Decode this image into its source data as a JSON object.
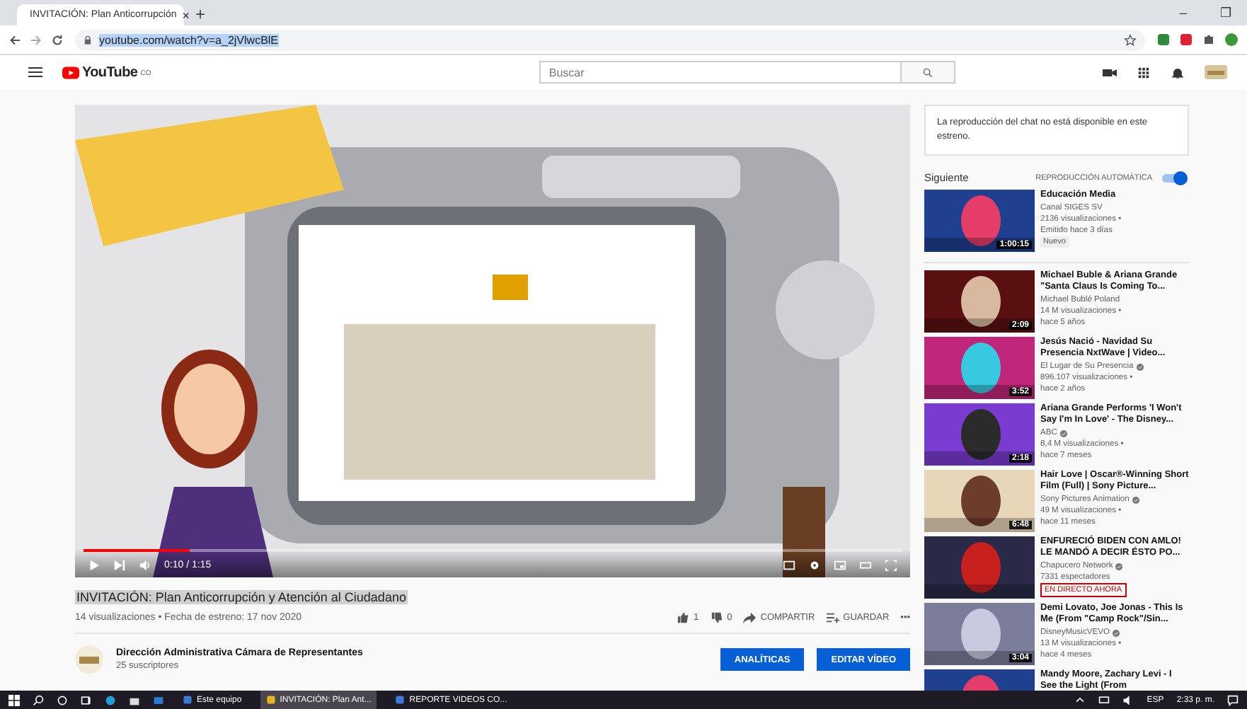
{
  "browser": {
    "tab": {
      "title": "INVITACIÓN: Plan Anticorrupción",
      "close": "×"
    },
    "new_tab": "+",
    "window_controls": [
      "–",
      "❐"
    ],
    "address": "youtube.com/watch?v=a_2jVlwcBlE"
  },
  "header": {
    "logo": "YouTube",
    "region": "CO",
    "search": {
      "placeholder": "Buscar"
    }
  },
  "player": {
    "level": 0.13,
    "time": "0:10 / 1:15"
  },
  "video": {
    "title": "INVITACIÓN: Plan Anticorrupción y Atención al Ciudadano",
    "meta": "14 visualizaciones • Fecha de estreno: 17 nov 2020",
    "likes": "1",
    "dislikes": "0",
    "share": "COMPARTIR",
    "save": "GUARDAR",
    "more": "•••"
  },
  "channel": {
    "name": "Dirección Administrativa Cámara de Representantes",
    "subscribers": "25 suscriptores",
    "buttons": [
      "ANALÍTICAS",
      "EDITAR VÍDEO"
    ]
  },
  "chat": {
    "message": "La reproducción del chat no está disponible en este estreno."
  },
  "up_next": {
    "label": "Siguiente",
    "autoplay_label": "REPRODUCCIÓN AUTOMÁTICA",
    "autoplay_on": true
  },
  "videos": [
    {
      "title": "Educación Media",
      "channel": "Canal SIGES SV",
      "verified": false,
      "views": "2136 visualizaciones •",
      "age": "Emitido hace 3 días",
      "duration": "1:00:15",
      "badge": {
        "kind": "new",
        "text": "Nuevo"
      }
    },
    {
      "title": "Michael Buble & Ariana Grande \"Santa Claus Is Coming To...",
      "channel": "Michael Bublé Poland",
      "verified": false,
      "views": "14 M visualizaciones •",
      "age": "hace 5 años",
      "duration": "2:09"
    },
    {
      "title": "Jesús Nació - Navidad Su Presencia NxtWave | Video...",
      "channel": "El Lugar de Su Presencia",
      "verified": true,
      "views": "896.107 visualizaciones •",
      "age": "hace 2 años",
      "duration": "3:52"
    },
    {
      "title": "Ariana Grande Performs 'I Won't Say I'm In Love' - The Disney...",
      "channel": "ABC",
      "verified": true,
      "views": "8,4 M visualizaciones •",
      "age": "hace 7 meses",
      "duration": "2:18"
    },
    {
      "title": "Hair Love | Oscar®-Winning Short Film (Full) | Sony Picture...",
      "channel": "Sony Pictures Animation",
      "verified": true,
      "views": "49 M visualizaciones •",
      "age": "hace 11 meses",
      "duration": "6:48"
    },
    {
      "title": "ENFURECIÓ BIDEN CON AMLO! LE MANDÓ A DECIR ÉSTO PO...",
      "channel": "Chapucero Network",
      "verified": true,
      "views": "7331 espectadores",
      "badge": {
        "kind": "live",
        "text": "EN DIRECTO AHORA"
      }
    },
    {
      "title": "Demi Lovato, Joe Jonas - This Is Me (From \"Camp Rock\"/Sin...",
      "channel": "DisneyMusicVEVO",
      "verified": true,
      "views": "13 M visualizaciones •",
      "age": "hace 4 meses",
      "duration": "3:04"
    },
    {
      "title": "Mandy Moore, Zachary Levi - I See the Light (From"
    }
  ],
  "taskbar": {
    "apps": [
      {
        "label": "Este equipo",
        "selected": false
      },
      {
        "label": "INVITACIÓN: Plan Ant...",
        "selected": true
      },
      {
        "label": "REPORTE VIDEOS CO...",
        "selected": false
      }
    ],
    "language": "ESP",
    "time": "2:33 p. m."
  }
}
